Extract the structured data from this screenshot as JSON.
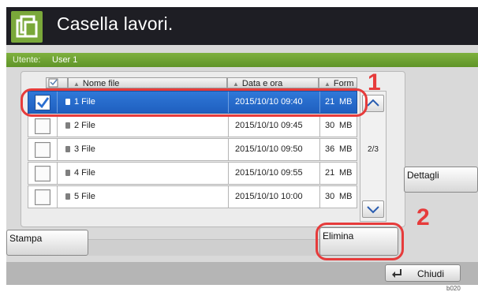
{
  "header": {
    "title": "Casella lavori."
  },
  "user": {
    "label": "Utente:",
    "name": "User 1"
  },
  "columns": {
    "name": "Nome file",
    "date": "Data e ora",
    "size": "Form"
  },
  "rows": [
    {
      "name": "1 File",
      "date": "2015/10/10 09:40",
      "size": "21",
      "unit": "MB",
      "checked": true
    },
    {
      "name": "2 File",
      "date": "2015/10/10 09:45",
      "size": "30",
      "unit": "MB",
      "checked": false
    },
    {
      "name": "3 File",
      "date": "2015/10/10 09:50",
      "size": "36",
      "unit": "MB",
      "checked": false
    },
    {
      "name": "4 File",
      "date": "2015/10/10 09:55",
      "size": "21",
      "unit": "MB",
      "checked": false
    },
    {
      "name": "5 File",
      "date": "2015/10/10 10:00",
      "size": "30",
      "unit": "MB",
      "checked": false
    }
  ],
  "pager": {
    "indicator": "2/3"
  },
  "buttons": {
    "details": "Dettagli",
    "print": "Stampa",
    "delete": "Elimina",
    "close": "Chiudi"
  },
  "callouts": {
    "first": "1",
    "second": "2"
  },
  "figure_code": "b020",
  "colors": {
    "accent_green": "#6fa532",
    "selection_blue": "#2a6ed0",
    "callout_red": "#e63b3b",
    "title_bar": "#1e1e24"
  }
}
